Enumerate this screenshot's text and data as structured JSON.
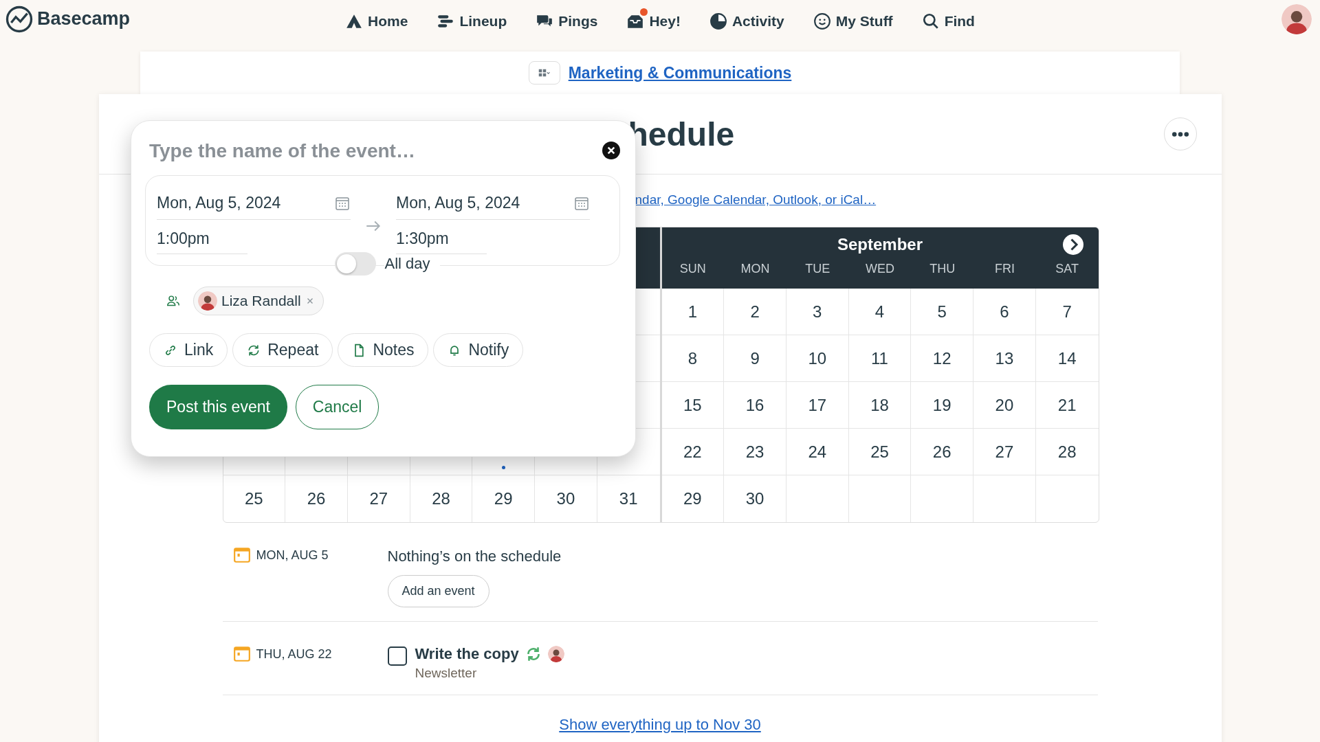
{
  "nav": {
    "logo": "Basecamp",
    "items": [
      {
        "label": "Home",
        "badge": false
      },
      {
        "label": "Lineup",
        "badge": false
      },
      {
        "label": "Pings",
        "badge": false
      },
      {
        "label": "Hey!",
        "badge": true
      },
      {
        "label": "Activity",
        "badge": false
      },
      {
        "label": "My Stuff",
        "badge": false
      },
      {
        "label": "Find",
        "badge": false
      }
    ]
  },
  "project": {
    "title": "Marketing & Communications"
  },
  "page": {
    "title": "hedule",
    "subscribe_link": "ndar, Google Calendar, Outlook, or iCal…"
  },
  "calendar": {
    "left_month": {
      "covered_row_events": [
        false,
        false,
        false,
        false,
        true,
        false,
        false
      ],
      "last_row": [
        "25",
        "26",
        "27",
        "28",
        "29",
        "30",
        "31"
      ]
    },
    "right_month": {
      "title": "September",
      "weekdays": [
        "SUN",
        "MON",
        "TUE",
        "WED",
        "THU",
        "FRI",
        "SAT"
      ],
      "weeks": [
        [
          "1",
          "2",
          "3",
          "4",
          "5",
          "6",
          "7"
        ],
        [
          "8",
          "9",
          "10",
          "11",
          "12",
          "13",
          "14"
        ],
        [
          "15",
          "16",
          "17",
          "18",
          "19",
          "20",
          "21"
        ],
        [
          "22",
          "23",
          "24",
          "25",
          "26",
          "27",
          "28"
        ],
        [
          "29",
          "30"
        ]
      ]
    }
  },
  "agenda": [
    {
      "kind": "empty",
      "date": "MON, AUG 5",
      "message": "Nothing’s on the schedule",
      "button": "Add an event"
    },
    {
      "kind": "todo",
      "date": "THU, AUG 22",
      "title": "Write the copy",
      "list": "Newsletter",
      "checked": false,
      "repeats": true
    }
  ],
  "show_more": "Show everything up to Nov 30",
  "popup": {
    "placeholder": "Type the name of the event…",
    "start": {
      "date": "Mon, Aug 5, 2024",
      "time": "1:00pm"
    },
    "end": {
      "date": "Mon, Aug 5, 2024",
      "time": "1:30pm"
    },
    "all_day": {
      "label": "All day",
      "on": false
    },
    "people": [
      {
        "name": "Liza Randall"
      }
    ],
    "options": [
      {
        "label": "Link"
      },
      {
        "label": "Repeat"
      },
      {
        "label": "Notes"
      },
      {
        "label": "Notify"
      }
    ],
    "submit": "Post this event",
    "cancel": "Cancel"
  }
}
